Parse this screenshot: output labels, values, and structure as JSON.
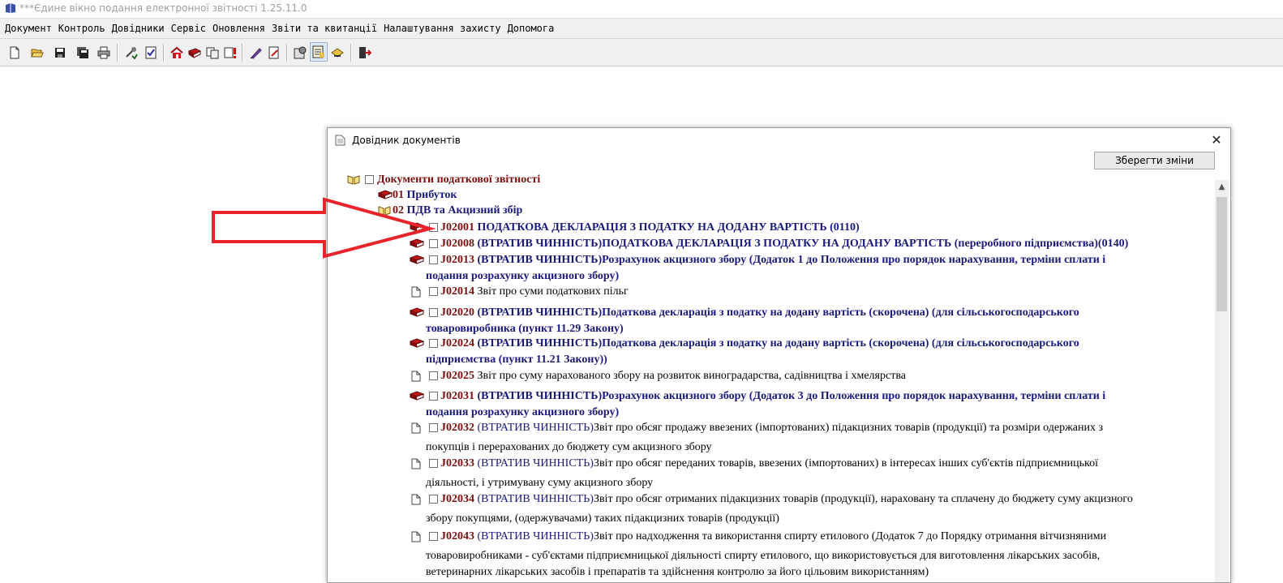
{
  "window": {
    "title": "***Єдине вікно подання електронної звітності 1.25.11.0"
  },
  "menu": [
    "Документ",
    "Контроль",
    "Довідники",
    "Сервіс",
    "Оновлення",
    "Звіти та квитанції",
    "Налаштування захисту",
    "Допомога"
  ],
  "dialog": {
    "title": "Довідник документів",
    "save_button": "Зберегти зміни",
    "close_glyph": "✕"
  },
  "tree": {
    "root": "Документи податкової звітності",
    "groups": [
      {
        "code": "01",
        "name": "Прибуток"
      },
      {
        "code": "02",
        "name": "ПДВ та Акцизний збір"
      }
    ],
    "items": [
      {
        "code": "J02001",
        "l1": "ПОДАТКОВА ДЕКЛАРАЦІЯ З ПОДАТКУ НА ДОДАНУ ВАРТІСТЬ (0110)"
      },
      {
        "code": "J02008",
        "l1": "(ВТРАТИВ ЧИННІСТЬ)ПОДАТКОВА ДЕКЛАРАЦІЯ З ПОДАТКУ НА ДОДАНУ ВАРТІСТЬ (переробного підприємства)(0140)"
      },
      {
        "code": "J02013",
        "l1": "(ВТРАТИВ ЧИННІСТЬ)Розрахунок акцизного збору (Додаток 1 до Положення про порядок нарахування, терміни сплати і",
        "l2": "подання розрахунку акцизного збору)"
      },
      {
        "code": "J02014",
        "l1": "Звіт про суми податкових пільг"
      },
      {
        "code": "J02020",
        "l1": "(ВТРАТИВ ЧИННІСТЬ)Податкова декларація з податку на додану вартість (скорочена) (для сільськогосподарського",
        "l2": "товаровиробника (пункт 11.29 Закону)"
      },
      {
        "code": "J02024",
        "l1": "(ВТРАТИВ ЧИННІСТЬ)Податкова декларація з податку на додану вартість (скорочена) (для сільськогосподарського",
        "l2": "підприємства (пункт 11.21 Закону))"
      },
      {
        "code": "J02025",
        "l1": "Звіт про суму нарахованого збору на розвиток виноградарства, садівництва і хмелярства"
      },
      {
        "code": "J02031",
        "l1": "(ВТРАТИВ ЧИННІСТЬ)Розрахунок акцизного збору (Додаток 3 до Положення про порядок нарахування, терміни сплати і",
        "l2": "подання розрахунку акцизного збору)"
      },
      {
        "code": "J02032",
        "status": "(ВТРАТИВ ЧИННІСТЬ)",
        "l1": "Звіт про обсяг продажу ввезених (імпортованих) підакцизних товарів (продукції) та розміри одержаних з",
        "l2": "покупців і перерахованих до бюджету сум акцизного збору"
      },
      {
        "code": "J02033",
        "status": "(ВТРАТИВ ЧИННІСТЬ)",
        "l1": "Звіт про обсяг переданих товарів, ввезених (імпортованих) в інтересах інших суб'єктів підприємницької",
        "l2": "діяльності, і утримувану суму акцизного збору"
      },
      {
        "code": "J02034",
        "status": "(ВТРАТИВ ЧИННІСТЬ)",
        "l1": "Звіт про обсяг отриманих підакцизних товарів (продукції), нараховану та сплачену до бюджету суму акцизного",
        "l2": "збору покупцями, (одержувачами) таких підакцизних товарів (продукції)"
      },
      {
        "code": "J02043",
        "status": "(ВТРАТИВ ЧИННІСТЬ)",
        "l1": "Звіт про надходження та використання спирту етилового (Додаток 7 до Порядку отримання вітчизняними",
        "l2": "товаровиробниками - суб'єктами підприємницької діяльності спирту етилового, що використовується для виготовлення лікарських засобів,",
        "l3": "ветеринарних лікарських засобів і препаратів та здійснення контролю за його цільовим використанням)"
      }
    ]
  },
  "colors": {
    "code": "#7a1010",
    "navy": "#1a1a7a",
    "arrow": "#e8232b"
  }
}
